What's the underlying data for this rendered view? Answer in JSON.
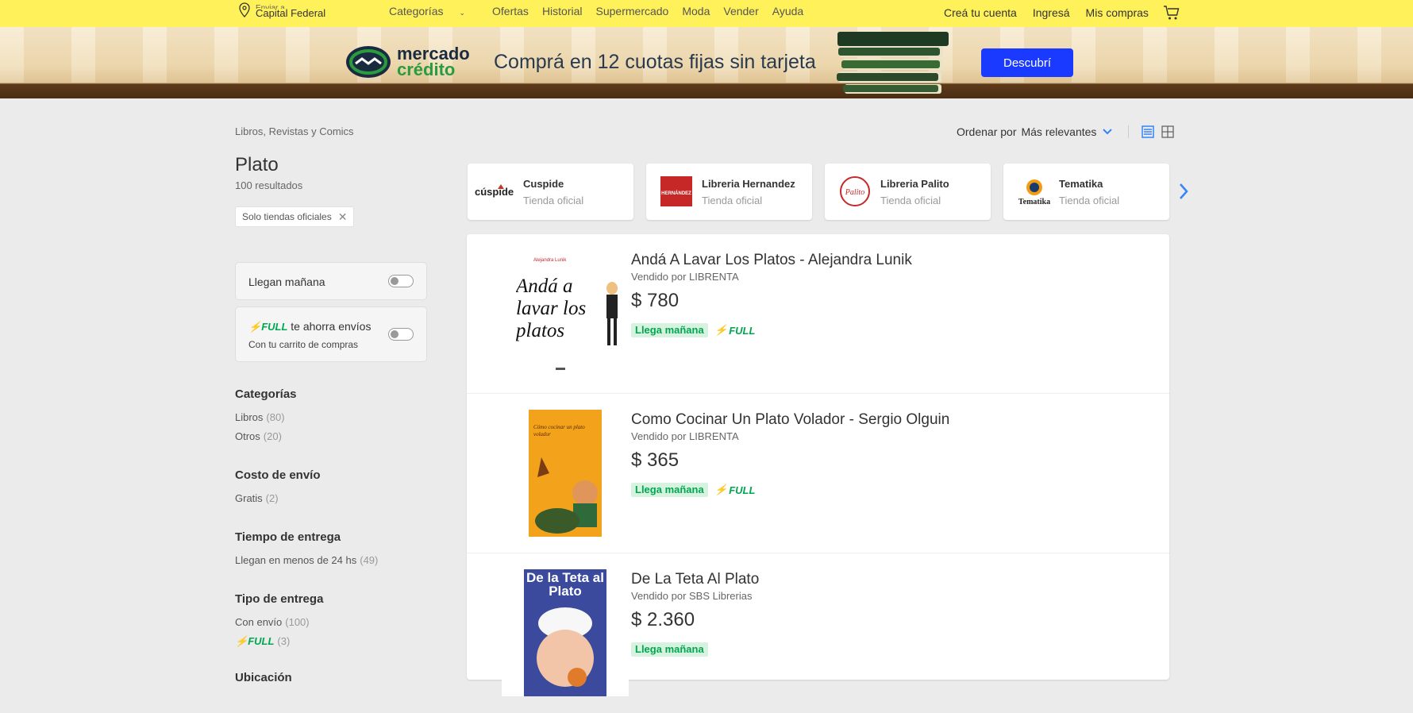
{
  "location": {
    "line1": "Enviar a",
    "line2": "Capital Federal"
  },
  "nav": {
    "items": [
      "Categorías",
      "Ofertas",
      "Historial",
      "Supermercado",
      "Moda",
      "Vender",
      "Ayuda"
    ]
  },
  "account": {
    "create": "Creá tu cuenta",
    "login": "Ingresá",
    "purchases": "Mis compras"
  },
  "banner": {
    "brand_top": "mercado",
    "brand_bottom": "crédito",
    "headline": "Comprá en 12 cuotas fijas sin tarjeta",
    "cta": "Descubrí"
  },
  "breadcrumb": "Libros, Revistas y Comics",
  "sort": {
    "label": "Ordenar por",
    "value": "Más relevantes"
  },
  "search": {
    "title": "Plato",
    "results": "100 resultados",
    "chip": "Solo tiendas oficiales"
  },
  "toggles": {
    "tomorrow": "Llegan mañana",
    "full_brand": "FULL",
    "full_text": "te ahorra envíos",
    "full_sub": "Con tu carrito de compras"
  },
  "filters": [
    {
      "title": "Categorías",
      "items": [
        {
          "label": "Libros",
          "count": "(80)"
        },
        {
          "label": "Otros",
          "count": "(20)"
        }
      ]
    },
    {
      "title": "Costo de envío",
      "items": [
        {
          "label": "Gratis",
          "count": "(2)"
        }
      ]
    },
    {
      "title": "Tiempo de entrega",
      "items": [
        {
          "label": "Llegan en menos de 24 hs",
          "count": "(49)"
        }
      ]
    },
    {
      "title": "Tipo de entrega",
      "items": [
        {
          "label": "Con envío",
          "count": "(100)"
        },
        {
          "label": "FULL",
          "count": "(3)"
        }
      ]
    },
    {
      "title": "Ubicación",
      "items": []
    }
  ],
  "stores": [
    {
      "name": "Cuspide",
      "tag": "Tienda oficial",
      "logo_text": "cúspide"
    },
    {
      "name": "Libreria Hernandez",
      "tag": "Tienda oficial",
      "logo_text": "HERNÁNDEZ"
    },
    {
      "name": "Libreria Palito",
      "tag": "Tienda oficial",
      "logo_text": "Palito"
    },
    {
      "name": "Tematika",
      "tag": "Tienda oficial",
      "logo_text": "Tematika"
    }
  ],
  "items": [
    {
      "title": "Andá A Lavar Los Platos - Alejandra Lunik",
      "seller": "Vendido por LIBRENTA",
      "price": "$ 780",
      "badge": "Llega mañana",
      "full": "FULL",
      "cover_text": "Andá a lavar los platos",
      "cover_author": "Alejandra Lunik"
    },
    {
      "title": "Como Cocinar Un Plato Volador - Sergio Olguin",
      "seller": "Vendido por LIBRENTA",
      "price": "$ 365",
      "badge": "Llega mañana",
      "full": "FULL",
      "cover_text": "Cómo cocinar un plato volador"
    },
    {
      "title": "De La Teta Al Plato",
      "seller": "Vendido por SBS Librerias",
      "price": "$ 2.360",
      "badge": "Llega mañana",
      "full": "",
      "cover_text": "De la Teta al Plato"
    }
  ],
  "colors": {
    "header": "#fff159",
    "accent": "#3483fa",
    "full": "#00a650",
    "cta": "#1a3bff"
  }
}
